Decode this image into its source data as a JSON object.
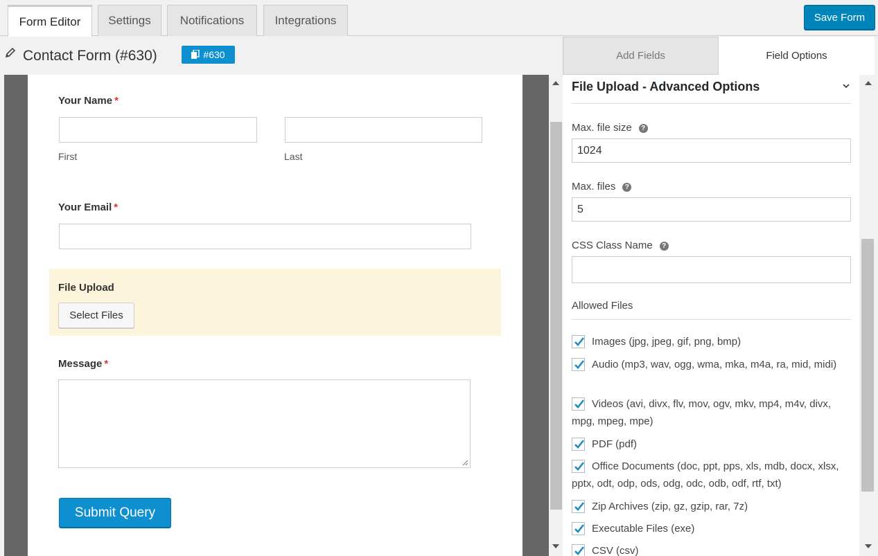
{
  "tabs": [
    {
      "label": "Form Editor",
      "active": true
    },
    {
      "label": "Settings",
      "active": false
    },
    {
      "label": "Notifications",
      "active": false
    },
    {
      "label": "Integrations",
      "active": false
    }
  ],
  "save_button": "Save Form",
  "form_title": "Contact Form (#630)",
  "form_id_badge": "#630",
  "preview": {
    "name_label": "Your Name",
    "name_first_sublabel": "First",
    "name_last_sublabel": "Last",
    "email_label": "Your Email",
    "upload_label": "File Upload",
    "select_files_button": "Select Files",
    "message_label": "Message",
    "required_marker": "*",
    "submit_button": "Submit Query"
  },
  "right_panel": {
    "tabs": [
      {
        "label": "Add Fields",
        "active": false
      },
      {
        "label": "Field Options",
        "active": true
      }
    ],
    "section_title": "File Upload - Advanced Options",
    "max_file_size_label": "Max. file size",
    "max_file_size_value": "1024",
    "max_files_label": "Max. files",
    "max_files_value": "5",
    "css_class_label": "CSS Class Name",
    "css_class_value": "",
    "allowed_files_label": "Allowed Files",
    "allowed_files": [
      {
        "label": "Images (jpg, jpeg, gif, png, bmp)",
        "checked": true
      },
      {
        "label": "Audio (mp3, wav, ogg, wma, mka, m4a, ra, mid, midi)",
        "checked": true
      },
      {
        "label": "Videos (avi, divx, flv, mov, ogv, mkv, mp4, m4v, divx, mpg, mpeg, mpe)",
        "checked": true
      },
      {
        "label": "PDF (pdf)",
        "checked": true
      },
      {
        "label": "Office Documents (doc, ppt, pps, xls, mdb, docx, xlsx, pptx, odt, odp, ods, odg, odc, odb, odf, rtf, txt)",
        "checked": true
      },
      {
        "label": "Zip Archives (zip, gz, gzip, rar, 7z)",
        "checked": true
      },
      {
        "label": "Executable Files (exe)",
        "checked": true
      },
      {
        "label": "CSV (csv)",
        "checked": true
      }
    ]
  },
  "colors": {
    "primary_button": "#0e8fcf",
    "upload_highlight": "#fdf4dc",
    "required": "#d63638"
  }
}
